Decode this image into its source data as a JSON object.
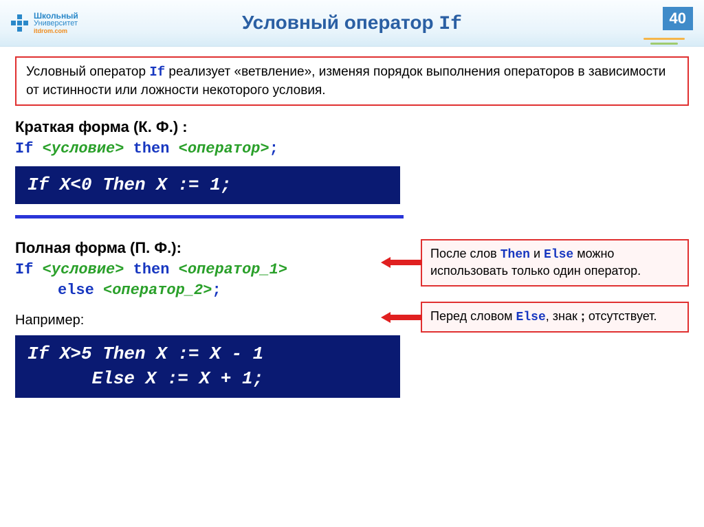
{
  "logo": {
    "line1": "Школьный",
    "line2": "Университет",
    "line3": "itdrom.com"
  },
  "page_number": "40",
  "title": {
    "text": "Условный оператор  ",
    "keyword": "If"
  },
  "info": {
    "pre1": "Условный оператор ",
    "kw": "If",
    "post1": " реализует «ветвление», изменяя порядок выполнения операторов в зависимости от истинности или ложности некоторого условия."
  },
  "short_form": {
    "label": "Краткая форма (К. Ф.) :",
    "syntax": {
      "if": "If ",
      "cond": "<условие>",
      "then": " then ",
      "op": "<оператор>",
      "semi": ";"
    },
    "code": "If X<0 Then X := 1;"
  },
  "full_form": {
    "label": "Полная форма (П. Ф.):",
    "syntax": {
      "if": "If ",
      "cond": "<условие>",
      "then": " then ",
      "op1": "<оператор_1>",
      "else": "else ",
      "op2": "<оператор_2>",
      "semi": ";"
    },
    "example_label": "Например:",
    "code": "If X>5 Then X := X - 1\n      Else X := X + 1;"
  },
  "notes": {
    "n1": {
      "pre": "После слов ",
      "kw1": "Then",
      "mid": " и ",
      "kw2": "Else",
      "post": " можно использовать только один оператор."
    },
    "n2": {
      "pre": "Перед словом ",
      "kw1": "Else",
      "mid": ", знак ",
      "kw2": ";",
      "post": " отсутствует."
    }
  }
}
